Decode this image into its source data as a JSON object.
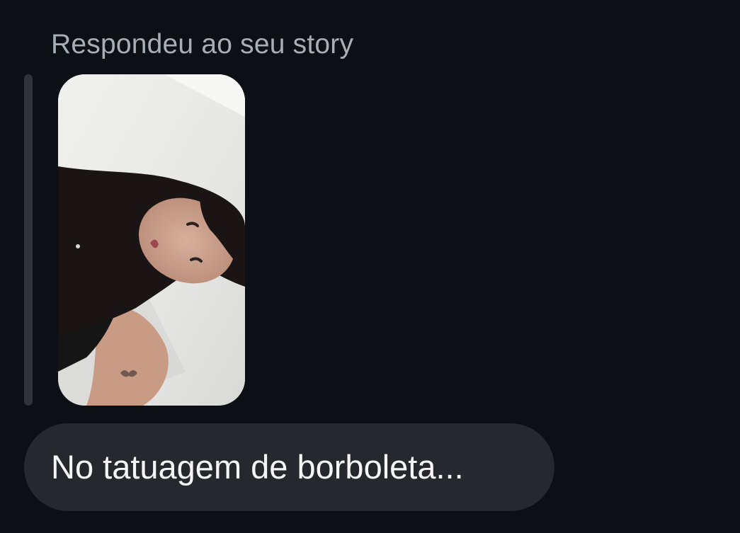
{
  "reply_context": {
    "label": "Respondeu ao seu story"
  },
  "story_preview": {
    "icon": "story-photo-thumbnail"
  },
  "message": {
    "text": "No tatuagem de borboleta..."
  },
  "colors": {
    "background": "#0c1014",
    "bubble": "#25292d",
    "label_text": "#a8aeb5",
    "message_text": "#f5f5f5",
    "quote_bar": "#2f3337"
  }
}
